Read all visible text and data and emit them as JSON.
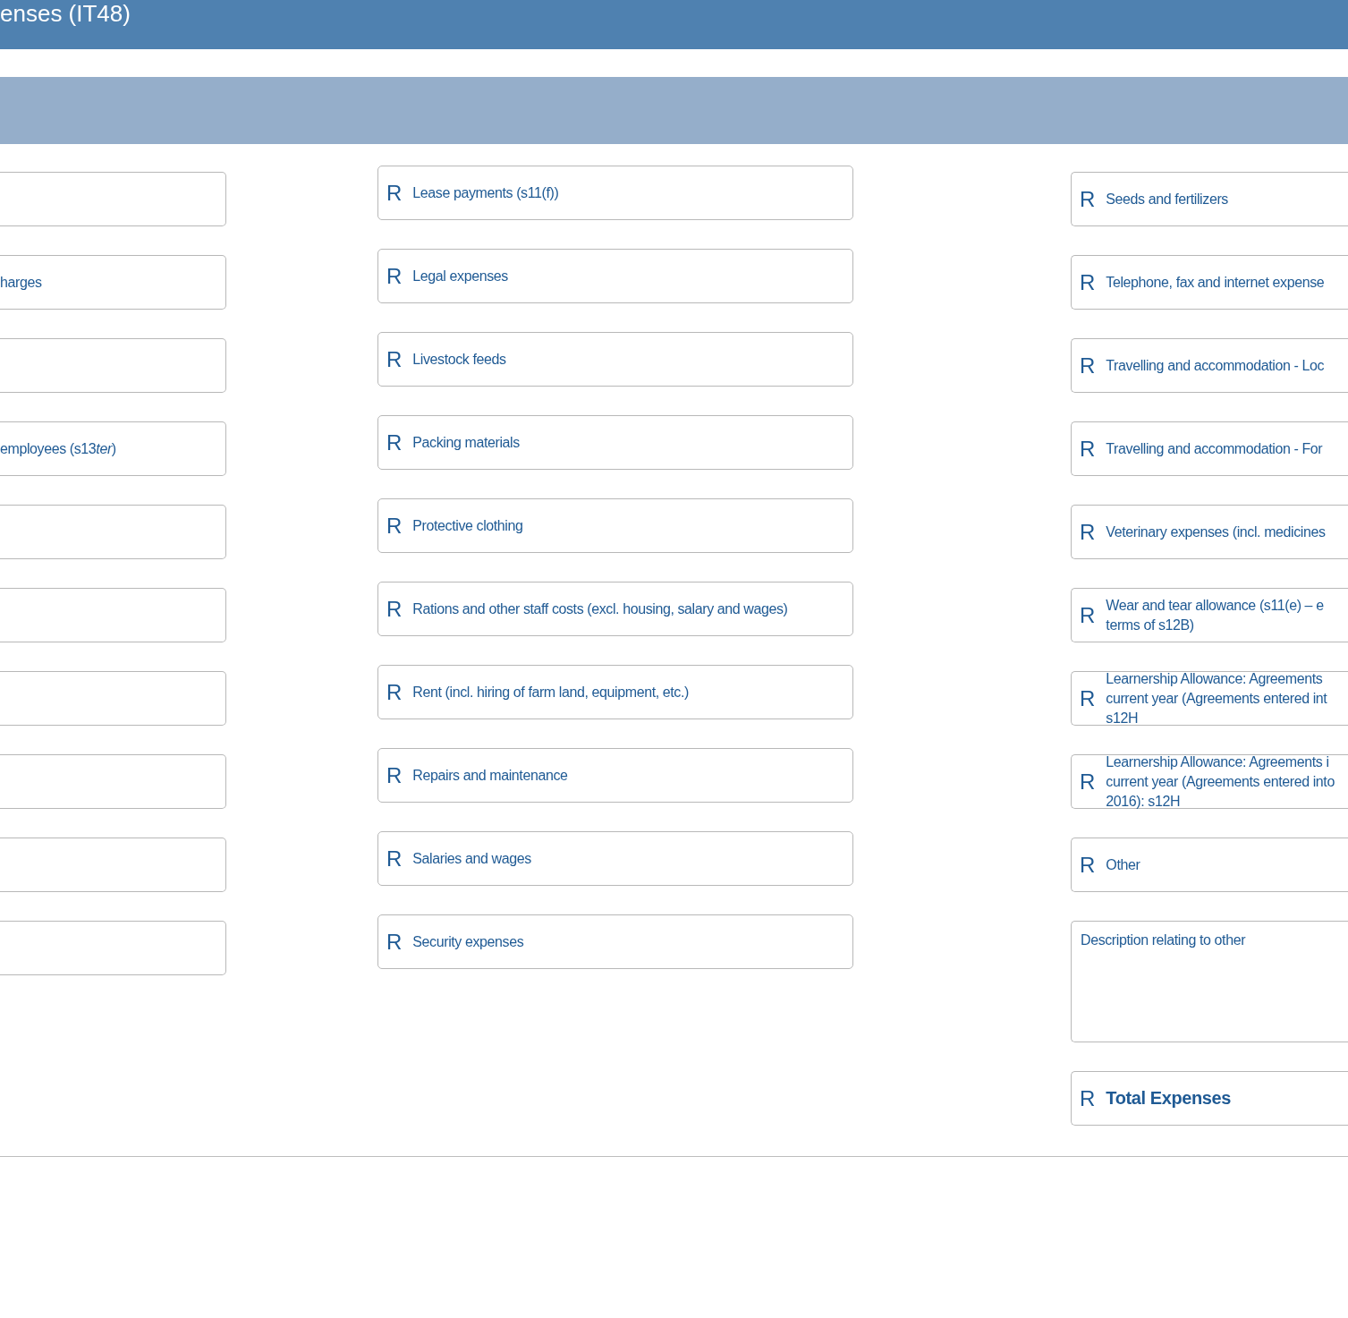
{
  "header": {
    "title": "enses (IT48)"
  },
  "left_fields": [
    {
      "kind": "blank"
    },
    {
      "kind": "labeled",
      "parts": [
        {
          "text": "harges",
          "italic": false
        }
      ]
    },
    {
      "kind": "blank"
    },
    {
      "kind": "labeled",
      "parts": [
        {
          "text": "employees (s13",
          "italic": false
        },
        {
          "text": "ter",
          "italic": true
        },
        {
          "text": ")",
          "italic": false
        }
      ]
    },
    {
      "kind": "blank"
    },
    {
      "kind": "blank"
    },
    {
      "kind": "blank"
    },
    {
      "kind": "blank"
    },
    {
      "kind": "blank"
    },
    {
      "kind": "blank"
    }
  ],
  "middle_fields": [
    {
      "currency": "R",
      "lines": [
        "Lease payments (s11(f))"
      ]
    },
    {
      "currency": "R",
      "lines": [
        "Legal expenses"
      ]
    },
    {
      "currency": "R",
      "lines": [
        "Livestock feeds"
      ]
    },
    {
      "currency": "R",
      "lines": [
        "Packing materials"
      ]
    },
    {
      "currency": "R",
      "lines": [
        "Protective clothing"
      ]
    },
    {
      "currency": "R",
      "lines": [
        "Rations and other staff costs (excl. housing, salary and wages)"
      ]
    },
    {
      "currency": "R",
      "lines": [
        "Rent (incl. hiring of farm land, equipment, etc.)"
      ]
    },
    {
      "currency": "R",
      "lines": [
        "Repairs and maintenance"
      ]
    },
    {
      "currency": "R",
      "lines": [
        "Salaries and wages"
      ]
    },
    {
      "currency": "R",
      "lines": [
        "Security expenses"
      ]
    }
  ],
  "right_fields": [
    {
      "currency": "R",
      "lines": [
        "Seeds and fertilizers"
      ]
    },
    {
      "currency": "R",
      "lines": [
        "Telephone, fax and internet expense"
      ]
    },
    {
      "currency": "R",
      "lines": [
        "Travelling and accommodation - Loc"
      ]
    },
    {
      "currency": "R",
      "lines": [
        "Travelling and accommodation - For"
      ]
    },
    {
      "currency": "R",
      "lines": [
        "Veterinary expenses (incl. medicines"
      ]
    },
    {
      "currency": "R",
      "lines": [
        "Wear and tear allowance (s11(e) – e",
        "terms of s12B)"
      ]
    },
    {
      "currency": "R",
      "lines": [
        "Learnership Allowance: Agreements",
        "current year (Agreements entered int",
        "s12H"
      ]
    },
    {
      "currency": "R",
      "lines": [
        "Learnership Allowance: Agreements i",
        "current year (Agreements entered into",
        "2016): s12H"
      ]
    },
    {
      "currency": "R",
      "lines": [
        "Other"
      ]
    }
  ],
  "description": {
    "label": "Description relating to other"
  },
  "total": {
    "currency": "R",
    "label": "Total Expenses"
  }
}
